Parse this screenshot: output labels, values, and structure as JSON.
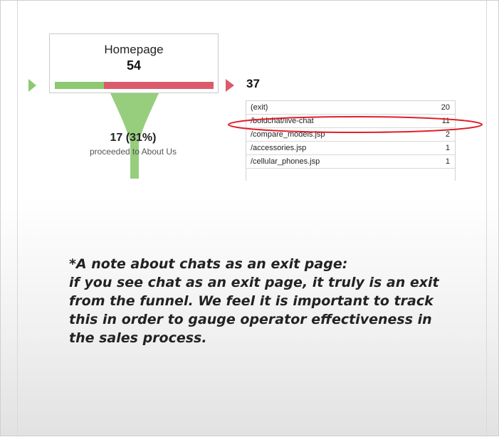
{
  "funnel_step": {
    "title": "Homepage",
    "count": "54",
    "proceeded_fraction": 0.31,
    "proceeded_count": "17 (31%)",
    "proceeded_label": "proceeded to About Us",
    "exit_count": "37"
  },
  "exit_table": {
    "rows": [
      {
        "page": "(exit)",
        "value": "20"
      },
      {
        "page": "/boldchat/live-chat",
        "value": "11",
        "highlighted": true
      },
      {
        "page": "/compare_models.jsp",
        "value": "2"
      },
      {
        "page": "/accessories.jsp",
        "value": "1"
      },
      {
        "page": "/cellular_phones.jsp",
        "value": "1"
      }
    ]
  },
  "note": {
    "lines": [
      "*A note about chats as an exit page:",
      "if you see chat as an exit page, it truly is an exit",
      "from the funnel.  We feel it is important to track",
      "this in order to gauge operator effectiveness in",
      "the sales process."
    ]
  },
  "colors": {
    "proceed_green": "#8cc970",
    "exit_red": "#db5b6b",
    "highlight_red": "#e0202a"
  }
}
